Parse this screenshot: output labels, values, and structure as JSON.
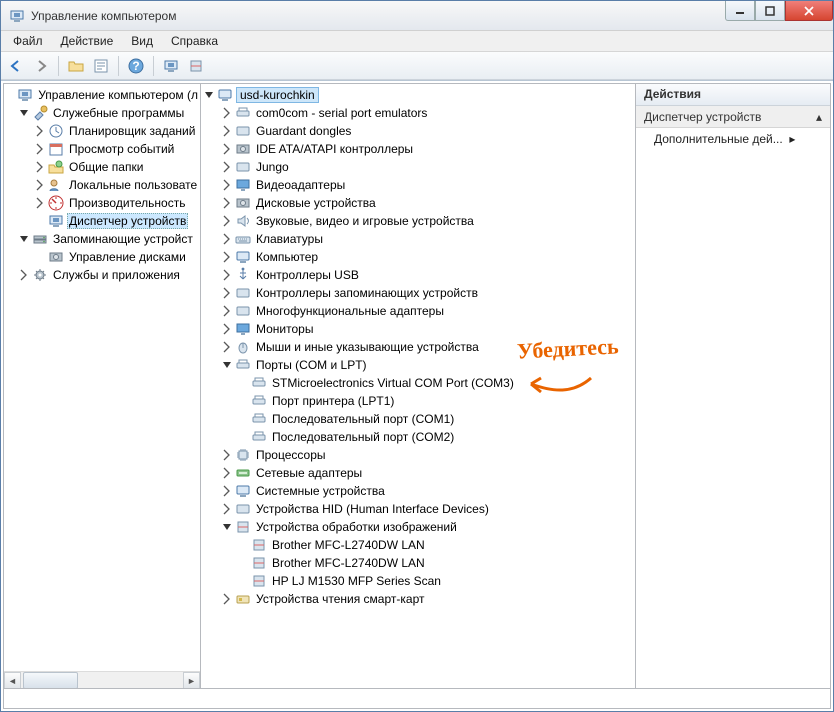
{
  "window": {
    "title": "Управление компьютером"
  },
  "menu": {
    "file": "Файл",
    "action": "Действие",
    "view": "Вид",
    "help": "Справка"
  },
  "leftTree": {
    "root": "Управление компьютером (л",
    "sys": "Служебные программы",
    "scheduler": "Планировщик заданий",
    "eventviewer": "Просмотр событий",
    "shared": "Общие папки",
    "localusers": "Локальные пользовате",
    "perf": "Производительность",
    "devmgr": "Диспетчер устройств",
    "storage": "Запоминающие устройст",
    "diskmgmt": "Управление дисками",
    "services": "Службы и приложения"
  },
  "devTree": {
    "root": "usd-kurochkin",
    "com0com": "com0com - serial port emulators",
    "guardant": "Guardant dongles",
    "ide": "IDE ATA/ATAPI контроллеры",
    "jungo": "Jungo",
    "video": "Видеоадаптеры",
    "disk": "Дисковые устройства",
    "sound": "Звуковые, видео и игровые устройства",
    "keyboards": "Клавиатуры",
    "computer": "Компьютер",
    "usbctrl": "Контроллеры USB",
    "storagectrl": "Контроллеры запоминающих устройств",
    "multifunc": "Многофункциональные адаптеры",
    "monitors": "Мониторы",
    "mice": "Мыши и иные указывающие устройства",
    "ports": "Порты (COM и LPT)",
    "port_stm": "STMicroelectronics Virtual COM Port (COM3)",
    "port_lpt1": "Порт принтера (LPT1)",
    "port_com1": "Последовательный порт (COM1)",
    "port_com2": "Последовательный порт (COM2)",
    "cpu": "Процессоры",
    "net": "Сетевые адаптеры",
    "sysdev": "Системные устройства",
    "hid": "Устройства HID (Human Interface Devices)",
    "imaging": "Устройства обработки изображений",
    "img_brother1": "Brother MFC-L2740DW LAN",
    "img_brother2": "Brother MFC-L2740DW LAN",
    "img_hp": "HP LJ M1530 MFP Series Scan",
    "smartcard": "Устройства чтения смарт-карт"
  },
  "actions": {
    "header": "Действия",
    "section": "Диспетчер устройств",
    "more": "Дополнительные дей..."
  },
  "annotation": "Убедитесь"
}
